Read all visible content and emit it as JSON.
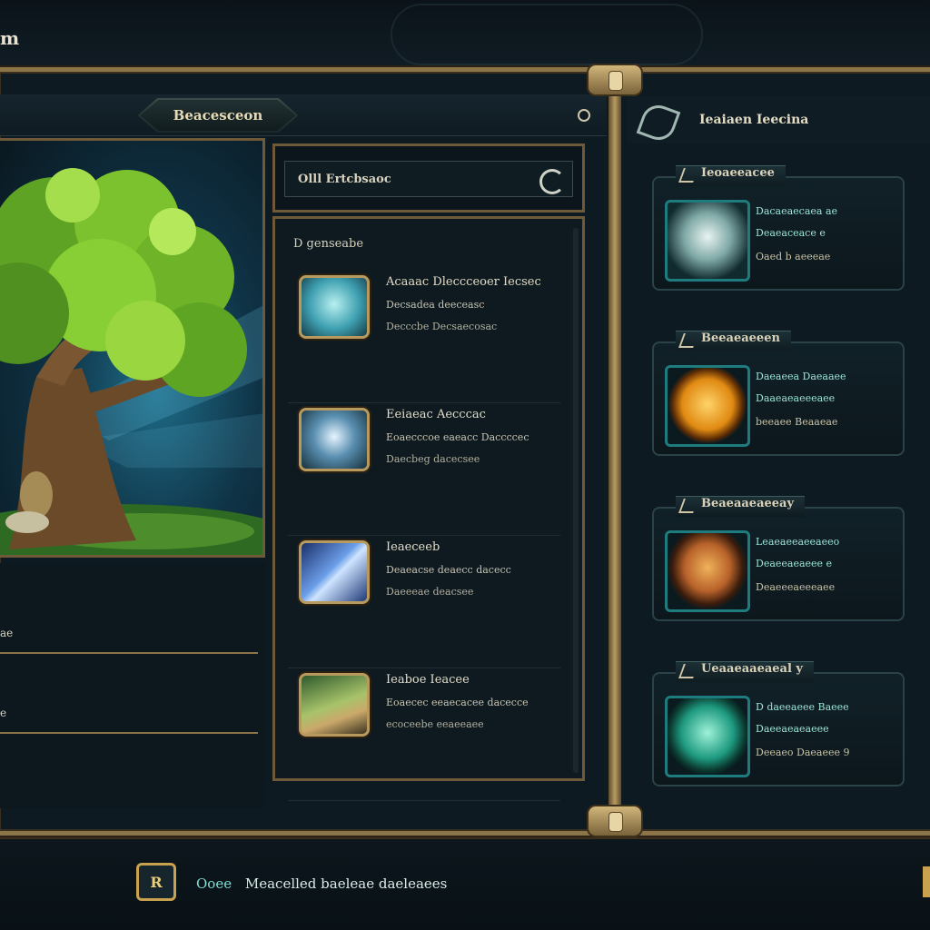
{
  "window": {
    "title": "m"
  },
  "left_panel": {
    "title": "Beacesceon",
    "stats": [
      "ae",
      "e"
    ]
  },
  "center_panel": {
    "search_value": "Olll Ertcbsaoc",
    "list_heading": "D genseabe",
    "items": [
      {
        "icon": "water-swirl-icon",
        "title": "Acaaac  Dleccceoer  Iecsec",
        "line1": "Decsadea deeceasc",
        "line2": "Decccbe  Decsaecosac"
      },
      {
        "icon": "crystal-orb-icon",
        "title": "Eeiaeac  Aecccac",
        "line1": "Eoaecccoe  eaeacc  Daccccec",
        "line2": "Daecbeg  dacecsee"
      },
      {
        "icon": "blue-shard-icon",
        "title": "Ieaeceeb",
        "line1": "Deaeacse  deaecc  dacecc",
        "line2": "Daeeeae  deacsee"
      },
      {
        "icon": "leaf-horn-icon",
        "title": "Ieaboe Ieacee",
        "line1": "Eoaecec  eeaecacee  dacecce",
        "line2": "ecoceebe  eeaeeaee"
      }
    ]
  },
  "right_panel": {
    "title": "Ieaiaen Ieecina",
    "cards": [
      {
        "tab": "Ieoaeeacee",
        "icon": "silver-gem-icon",
        "line1": "Dacaeaecaea ae",
        "line2": "Deaeaceace e",
        "line3": "Oaed  b  aeeeae"
      },
      {
        "tab": "Beeaeaeeen",
        "icon": "gold-coin-icon",
        "line1": "Daeaeea Daeaaee",
        "line2": "Daaeaeaeeeaee",
        "line3": "beeaee  Beaaeae"
      },
      {
        "tab": "Beaeaaeaeeay",
        "icon": "amber-chalice-icon",
        "line1": "Leaeaeeaeeaeeo",
        "line2": "Deaeeaeaeee e",
        "line3": "Deaeeeaeeeaee"
      },
      {
        "tab": "Ueaaeaaeaeal y",
        "icon": "emerald-leaf-icon",
        "line1": "D  daeeaeee Baeee",
        "line2": "Daeeaeaeaeee",
        "line3": "Deeaeo  Daeaeee  9"
      }
    ]
  },
  "status_bar": {
    "icon_label": "R",
    "tag": "Ooee",
    "text": "Meacelled  baeleae  daeleaees"
  },
  "colors": {
    "frame_bronze": "#8a7448",
    "panel_bg": "#0e1a21",
    "accent_teal": "#1f7c7e",
    "text_teal": "#9be3d6",
    "gold": "#c8a24e"
  }
}
